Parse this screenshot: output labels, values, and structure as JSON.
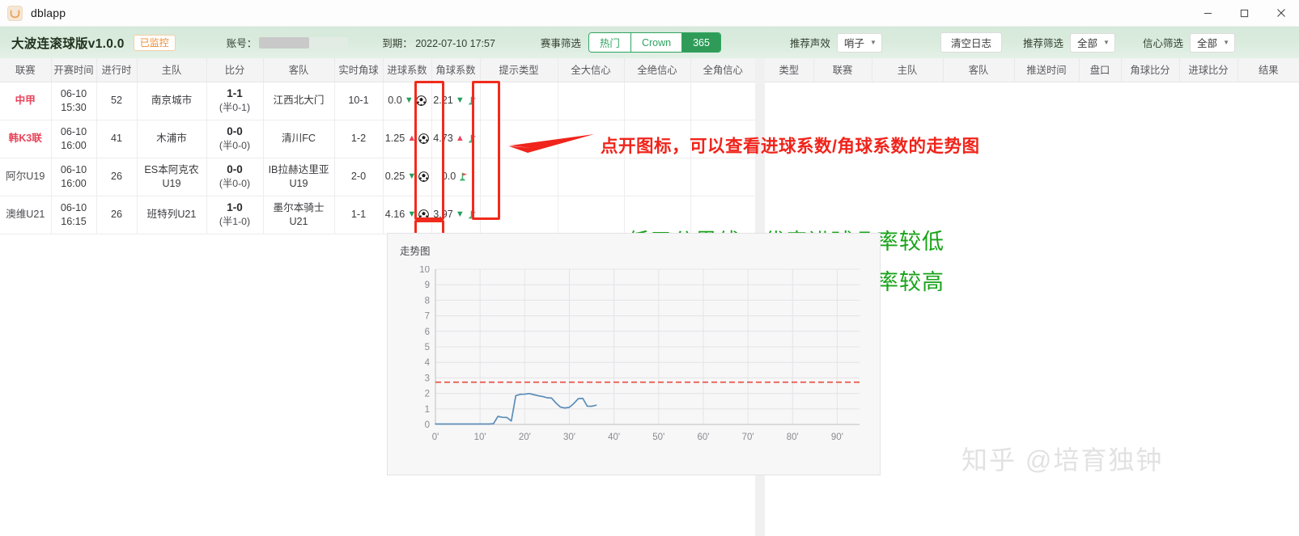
{
  "window": {
    "title": "dblapp",
    "icon": "app-logo-icon",
    "controls": {
      "minimize": "—",
      "maximize": "☐",
      "close": "✕"
    }
  },
  "toolbar": {
    "brand": "大波连滚球版v1.0.0",
    "monitor_badge": "已监控",
    "account_label": "账号：",
    "account_value": "",
    "expire_label": "到期： 2022-07-10 17:57",
    "match_filter_label": "赛事筛选",
    "segments": [
      {
        "label": "热门",
        "active": false
      },
      {
        "label": "Crown",
        "active": false
      },
      {
        "label": "365",
        "active": true
      }
    ],
    "sound_label": "推荐声效",
    "sound_value": "哨子",
    "clear_log_label": "清空日志",
    "rec_filter_label": "推荐筛选",
    "rec_filter_value": "全部",
    "conf_filter_label": "信心筛选",
    "conf_filter_value": "全部",
    "accent_green": "#2e9c58",
    "accent_orange": "#ef8c34"
  },
  "left_table": {
    "columns": [
      "联赛",
      "开赛时间",
      "进行时",
      "主队",
      "比分",
      "客队",
      "实时角球",
      "进球系数",
      "角球系数",
      "提示类型",
      "全大信心",
      "全绝信心",
      "全角信心"
    ],
    "rows": [
      {
        "league": "中甲",
        "league_hot": true,
        "kickoff_date": "06-10",
        "kickoff_time": "15:30",
        "minute": "52",
        "home": "南京城市",
        "score": "1-1",
        "half": "(半0-1)",
        "away": "江西北大门",
        "corners": "10-1",
        "goal_coef": "0.0",
        "goal_dir": "down",
        "corner_coef": "2.21",
        "corner_dir": "down",
        "tip_type": "",
        "conf_big": "",
        "conf_abs": "",
        "conf_corner": ""
      },
      {
        "league": "韩K3联",
        "league_hot": true,
        "kickoff_date": "06-10",
        "kickoff_time": "16:00",
        "minute": "41",
        "home": "木浦市",
        "score": "0-0",
        "half": "(半0-0)",
        "away": "清川FC",
        "corners": "1-2",
        "goal_coef": "1.25",
        "goal_dir": "up",
        "corner_coef": "4.73",
        "corner_dir": "up",
        "tip_type": "",
        "conf_big": "",
        "conf_abs": "",
        "conf_corner": ""
      },
      {
        "league": "阿尔U19",
        "league_hot": false,
        "kickoff_date": "06-10",
        "kickoff_time": "16:00",
        "minute": "26",
        "home": "ES本阿克农U19",
        "score": "0-0",
        "half": "(半0-0)",
        "away": "IB拉赫达里亚U19",
        "corners": "2-0",
        "goal_coef": "0.25",
        "goal_dir": "down",
        "corner_coef": "0.0",
        "corner_dir": "none",
        "tip_type": "",
        "conf_big": "",
        "conf_abs": "",
        "conf_corner": ""
      },
      {
        "league": "澳维U21",
        "league_hot": false,
        "kickoff_date": "06-10",
        "kickoff_time": "16:15",
        "minute": "26",
        "home": "班特列U21",
        "score": "1-0",
        "half": "(半1-0)",
        "away": "墨尔本骑士U21",
        "corners": "1-1",
        "goal_coef": "4.16",
        "goal_dir": "down",
        "corner_coef": "3.97",
        "corner_dir": "down",
        "tip_type": "",
        "conf_big": "",
        "conf_abs": "",
        "conf_corner": ""
      }
    ]
  },
  "right_table": {
    "columns": [
      "类型",
      "联赛",
      "主队",
      "客队",
      "推送时间",
      "盘口",
      "角球比分",
      "进球比分",
      "结果"
    ],
    "rows": []
  },
  "annotations": {
    "red_note": "点开图标，可以查看进球系数/角球系数的走势图",
    "green_note_1": "低于分界线，代表进球几率较低",
    "green_note_2": "高于分界线，代表进球几率较高",
    "red_color": "#f0241b",
    "green_color": "#19a319"
  },
  "watermark": {
    "text": "知乎 @培育独钟"
  },
  "chart_data": {
    "type": "line",
    "title": "走势图",
    "xlabel": "",
    "ylabel": "",
    "xlim": [
      0,
      95
    ],
    "ylim": [
      0,
      10
    ],
    "yticks": [
      0,
      1,
      2,
      3,
      4,
      5,
      6,
      7,
      8,
      9,
      10
    ],
    "xticks": [
      0,
      10,
      20,
      30,
      40,
      50,
      60,
      70,
      80,
      90
    ],
    "xticklabels": [
      "0'",
      "10'",
      "20'",
      "30'",
      "40'",
      "50'",
      "60'",
      "70'",
      "80'",
      "90'"
    ],
    "grid": true,
    "legend": "none",
    "series": [
      {
        "name": "进球系数",
        "color": "#5b8db8",
        "x": [
          0,
          1,
          2,
          3,
          4,
          5,
          6,
          7,
          8,
          9,
          10,
          11,
          12,
          13,
          14,
          15,
          16,
          17,
          18,
          19,
          20,
          21,
          22,
          23,
          24,
          25,
          26,
          27,
          28,
          29,
          30,
          31,
          32,
          33,
          34,
          35,
          36
        ],
        "y": [
          0.03,
          0.03,
          0.03,
          0.03,
          0.03,
          0.03,
          0.03,
          0.03,
          0.03,
          0.03,
          0.03,
          0.03,
          0.03,
          0.05,
          0.52,
          0.46,
          0.45,
          0.22,
          1.85,
          1.94,
          1.95,
          1.99,
          1.92,
          1.85,
          1.8,
          1.72,
          1.7,
          1.38,
          1.12,
          1.06,
          1.1,
          1.35,
          1.66,
          1.68,
          1.18,
          1.17,
          1.24
        ]
      }
    ],
    "threshold_line": {
      "value": 2.72,
      "color": "#e8564a",
      "style": "dashed",
      "label": "分界线"
    }
  }
}
